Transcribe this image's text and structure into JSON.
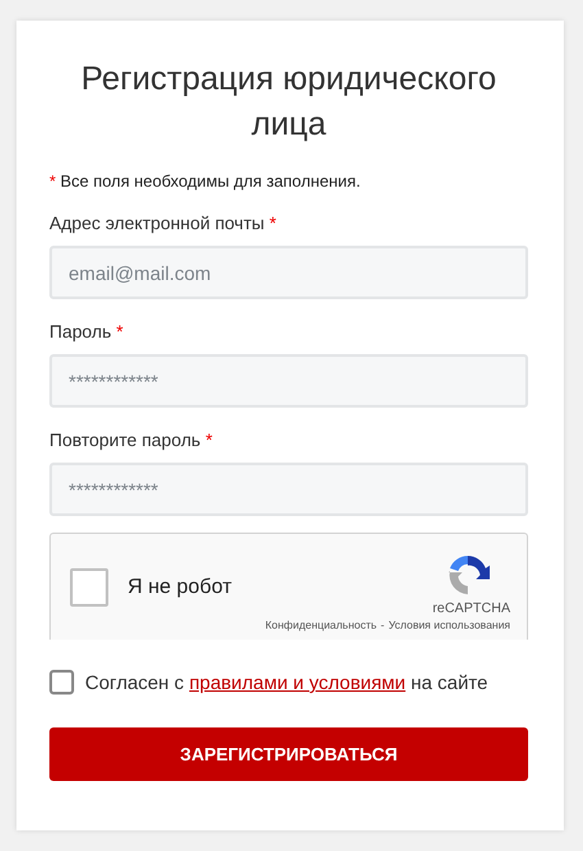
{
  "title": "Регистрация юридического лица",
  "note": {
    "mark": "*",
    "text": "Все поля необходимы для заполнения."
  },
  "fields": [
    {
      "label": "Адрес электронной почты",
      "required_mark": "*",
      "placeholder": "email@mail.com"
    },
    {
      "label": "Пароль",
      "required_mark": "*",
      "value": "************"
    },
    {
      "label": "Повторите пароль",
      "required_mark": "*",
      "value": "************"
    }
  ],
  "captcha": {
    "checked": false,
    "label": "Я не робот",
    "brand": "reCAPTCHA",
    "privacy_link": "Конфиденциальность",
    "separator": "-",
    "terms_link": "Условия использования"
  },
  "agree": {
    "checked": false,
    "text_before": "Согласен с",
    "link": "правилами и условиями",
    "text_after": "на сайте"
  },
  "submit_button": "ЗАРЕГИСТРИРОВАТЬСЯ"
}
